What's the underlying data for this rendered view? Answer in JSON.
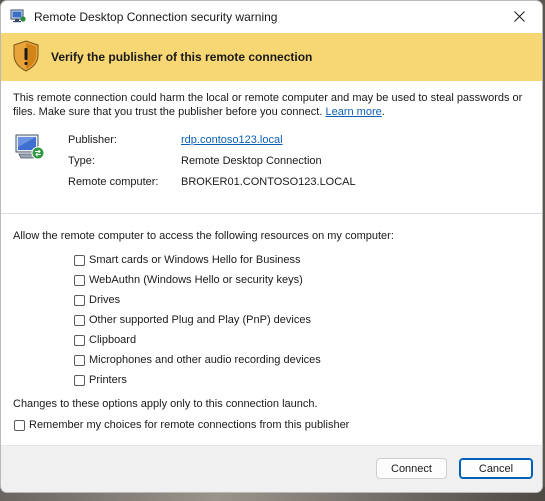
{
  "window": {
    "title": "Remote Desktop Connection security warning"
  },
  "banner": {
    "heading": "Verify the publisher of this remote connection",
    "icon": "shield-warning-icon"
  },
  "warning": {
    "text": "This remote connection could harm the local or remote computer and may be used to steal passwords or files. Make sure that you trust the publisher before you connect.",
    "link_label": "Learn more",
    "end": "."
  },
  "details": {
    "icon": "remote-computer-icon",
    "publisher_label": "Publisher:",
    "publisher_value": "rdp.contoso123.local",
    "type_label": "Type:",
    "type_value": "Remote Desktop Connection",
    "remote_label": "Remote computer:",
    "remote_value": "BROKER01.CONTOSO123.LOCAL"
  },
  "resources": {
    "intro": "Allow the remote computer to access the following resources on my computer:",
    "items": [
      {
        "label": "Smart cards or Windows Hello for Business",
        "checked": false
      },
      {
        "label": "WebAuthn (Windows Hello or security keys)",
        "checked": false
      },
      {
        "label": "Drives",
        "checked": false
      },
      {
        "label": "Other supported Plug and Play (PnP) devices",
        "checked": false
      },
      {
        "label": "Clipboard",
        "checked": false
      },
      {
        "label": "Microphones and other audio recording devices",
        "checked": false
      },
      {
        "label": "Printers",
        "checked": false
      }
    ]
  },
  "note": "Changes to these options apply only to this connection launch.",
  "remember": {
    "label": "Remember my choices for remote connections from this publisher",
    "checked": false
  },
  "buttons": {
    "connect": "Connect",
    "cancel": "Cancel"
  },
  "colors": {
    "banner": "#f6d774",
    "link": "#0b5fb6",
    "default_button_border": "#005fb8"
  }
}
